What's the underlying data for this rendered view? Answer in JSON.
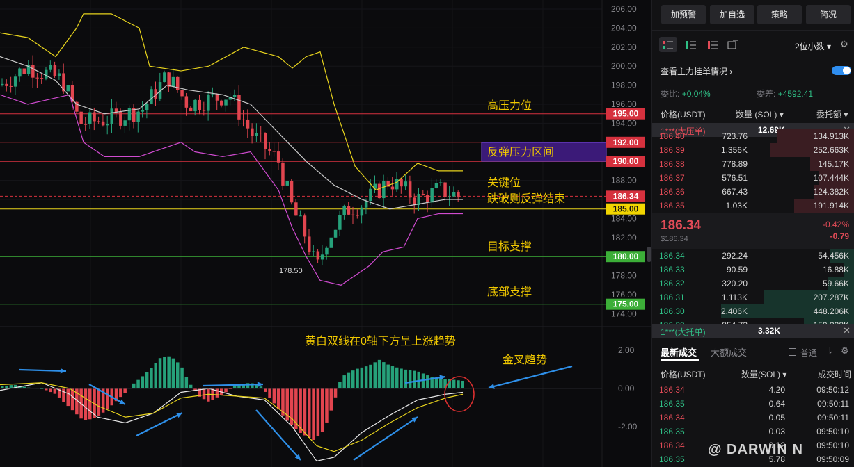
{
  "chart": {
    "price_axis": [
      "206.00",
      "204.00",
      "202.00",
      "200.00",
      "198.00",
      "196.00",
      "194.00",
      "192.00",
      "190.00",
      "188.00",
      "186.00",
      "184.00",
      "182.00",
      "180.00",
      "178.00",
      "176.00",
      "174.00"
    ],
    "macd_axis": [
      "2.00",
      "0.00",
      "-2.00"
    ],
    "level_tags": [
      {
        "value": "195.00",
        "color": "#d6313e",
        "text_color": "#ffffff"
      },
      {
        "value": "192.00",
        "color": "#d6313e",
        "text_color": "#ffffff"
      },
      {
        "value": "190.00",
        "color": "#d6313e",
        "text_color": "#ffffff"
      },
      {
        "value": "186.34",
        "color": "#d6313e",
        "text_color": "#ffffff"
      },
      {
        "value": "185.00",
        "color": "#f2d500",
        "text_color": "#111111"
      },
      {
        "value": "180.00",
        "color": "#3cae38",
        "text_color": "#ffffff"
      },
      {
        "value": "175.00",
        "color": "#3cae38",
        "text_color": "#ffffff"
      }
    ],
    "annotations": {
      "high_resistance": "高压力位",
      "rebound_zone": "反弹压力区间",
      "key_level": "关键位",
      "break_rebound_end": "跌破则反弹结束",
      "target_support": "目标支撑",
      "bottom_support": "底部支撑",
      "low_marker": "178.50",
      "macd_note": "黄白双线在0轴下方呈上涨趋势",
      "golden_cross": "金叉趋势"
    },
    "colors": {
      "up": "#26a17a",
      "down": "#e2454f",
      "boll_mid": "#c9c9c9",
      "boll_up": "#e7d31d",
      "boll_low": "#d04bd0",
      "arrow": "#2e8fe8"
    }
  },
  "panel": {
    "buttons": [
      "加预警",
      "加自选",
      "策略",
      "简况"
    ],
    "icons": [
      "orderbook-both-icon",
      "orderbook-buy-icon",
      "orderbook-sell-icon",
      "expand-icon"
    ],
    "decimals": "2位小数",
    "depth_title": "查看主力挂单情况",
    "ratio_label": "委比:",
    "ratio_value": "+0.04%",
    "diff_label": "委差:",
    "diff_value": "+4592.41",
    "col_price": "价格(USDT)",
    "col_qty": "数量 (SOL)",
    "col_total": "委托额",
    "big_sell_label": "1***(大压单)",
    "big_sell_value": "12.69K",
    "asks": [
      {
        "price": "186.40",
        "qty": "723.76",
        "total": "134.913K",
        "depth": 0.38
      },
      {
        "price": "186.39",
        "qty": "1.356K",
        "total": "252.663K",
        "depth": 0.42
      },
      {
        "price": "186.38",
        "qty": "778.89",
        "total": "145.17K",
        "depth": 0.22
      },
      {
        "price": "186.37",
        "qty": "576.51",
        "total": "107.444K",
        "depth": 0.18
      },
      {
        "price": "186.36",
        "qty": "667.43",
        "total": "124.382K",
        "depth": 0.2
      },
      {
        "price": "186.35",
        "qty": "1.03K",
        "total": "191.914K",
        "depth": 0.3
      }
    ],
    "last_price": "186.34",
    "last_usd": "$186.34",
    "change_pct": "-0.42%",
    "change_abs": "-0.79",
    "bids": [
      {
        "price": "186.34",
        "qty": "292.24",
        "total": "54.456K",
        "depth": 0.12
      },
      {
        "price": "186.33",
        "qty": "90.59",
        "total": "16.88K",
        "depth": 0.05
      },
      {
        "price": "186.32",
        "qty": "320.20",
        "total": "59.66K",
        "depth": 0.13
      },
      {
        "price": "186.31",
        "qty": "1.113K",
        "total": "207.287K",
        "depth": 0.45
      },
      {
        "price": "186.30",
        "qty": "2.406K",
        "total": "448.206K",
        "depth": 0.66
      },
      {
        "price": "186.29",
        "qty": "854.73",
        "total": "159.228K",
        "depth": 0.25
      }
    ],
    "big_buy_label": "1***(大托单)",
    "big_buy_value": "3.32K",
    "tab_latest": "最新成交",
    "tab_large": "大额成交",
    "normal_label": "普通",
    "trade_col_price": "价格(USDT)",
    "trade_col_qty": "数量(SOL)",
    "trade_col_time": "成交时间",
    "trades": [
      {
        "price": "186.34",
        "qty": "4.20",
        "time": "09:50:12",
        "side": "sell"
      },
      {
        "price": "186.35",
        "qty": "0.64",
        "time": "09:50:11",
        "side": "buy"
      },
      {
        "price": "186.34",
        "qty": "0.05",
        "time": "09:50:11",
        "side": "sell"
      },
      {
        "price": "186.35",
        "qty": "0.03",
        "time": "09:50:10",
        "side": "buy"
      },
      {
        "price": "186.34",
        "qty": "0.12",
        "time": "09:50:10",
        "side": "sell"
      },
      {
        "price": "186.35",
        "qty": "5.78",
        "time": "09:50:09",
        "side": "buy"
      }
    ],
    "watermark": "@ DARWIN N"
  }
}
